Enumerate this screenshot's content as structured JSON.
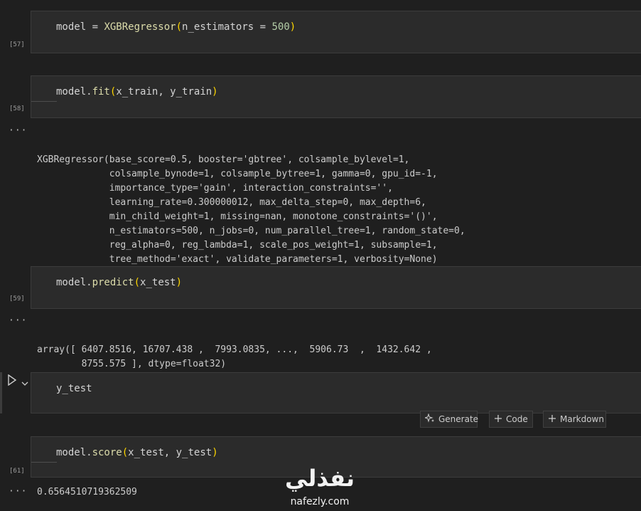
{
  "cells": [
    {
      "exec": "[57]",
      "code": {
        "obj": "model = ",
        "fn": "XGBRegressor",
        "open": "(",
        "arg": "n_estimators = ",
        "num": "500",
        "close": ")"
      }
    },
    {
      "exec": "[58]",
      "code": {
        "obj": "model.",
        "fn": "fit",
        "open": "(",
        "arg": "x_train, y_train",
        "close": ")"
      }
    },
    {
      "exec": "[59]",
      "code": {
        "obj": "model.",
        "fn": "predict",
        "open": "(",
        "arg": "x_test",
        "close": ")"
      }
    },
    {
      "exec": "",
      "code": {
        "text": "y_test"
      }
    },
    {
      "exec": "[61]",
      "code": {
        "obj": "model.",
        "fn": "score",
        "open": "(",
        "arg": "x_test, y_test",
        "close": ")"
      }
    }
  ],
  "outputs": {
    "fit": [
      "XGBRegressor(base_score=0.5, booster='gbtree', colsample_bylevel=1,",
      "             colsample_bynode=1, colsample_bytree=1, gamma=0, gpu_id=-1,",
      "             importance_type='gain', interaction_constraints='',",
      "             learning_rate=0.300000012, max_delta_step=0, max_depth=6,",
      "             min_child_weight=1, missing=nan, monotone_constraints='()',",
      "             n_estimators=500, n_jobs=0, num_parallel_tree=1, random_state=0,",
      "             reg_alpha=0, reg_lambda=1, scale_pos_weight=1, subsample=1,",
      "             tree_method='exact', validate_parameters=1, verbosity=None)"
    ],
    "predict": [
      "array([ 6407.8516, 16707.438 ,  7993.0835, ...,  5906.73  ,  1432.642 ,",
      "        8755.575 ], dtype=float32)"
    ],
    "score": "0.6564510719362509",
    "ellipsis": "···"
  },
  "toolbar": {
    "generate": "Generate",
    "code": "Code",
    "markdown": "Markdown"
  },
  "watermark": {
    "arabic": "نفذلي",
    "url": "nafezly.com"
  },
  "icons": {
    "run": "run-icon",
    "chevron": "chevron-down-icon",
    "sparkle": "sparkle-icon",
    "plus": "plus-icon"
  }
}
